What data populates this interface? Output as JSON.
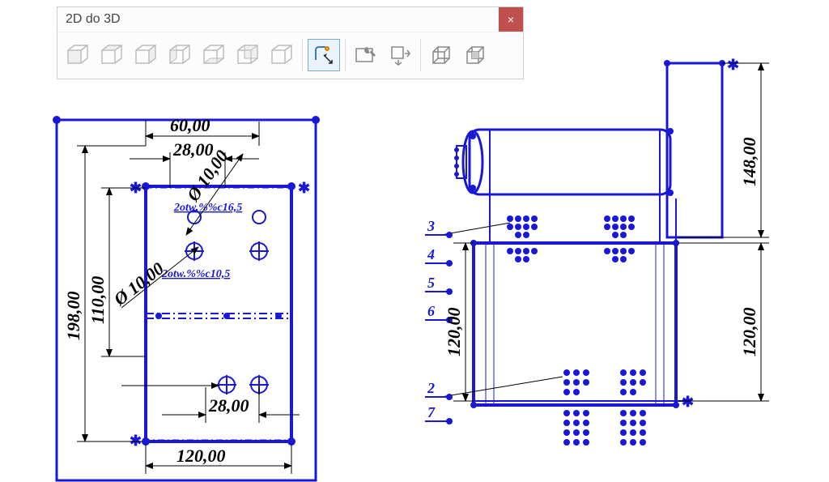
{
  "toolbar": {
    "title": "2D do 3D",
    "close": "×",
    "buttons": [
      {
        "name": "front-view"
      },
      {
        "name": "top-view"
      },
      {
        "name": "right-view"
      },
      {
        "name": "left-view"
      },
      {
        "name": "bottom-view"
      },
      {
        "name": "back-view"
      },
      {
        "name": "aux-view"
      },
      {
        "name": "sketch-from-selection"
      },
      {
        "name": "repair-sketch"
      },
      {
        "name": "align-sketch"
      },
      {
        "name": "extrude"
      },
      {
        "name": "cut"
      }
    ]
  },
  "drawing": {
    "left_view": {
      "dims": {
        "d60": "60,00",
        "d28_top": "28,00",
        "d28_bot": "28,00",
        "d120": "120,00",
        "d110": "110,00",
        "d198": "198,00",
        "phi10": "Ø 10,00",
        "phi13": "Ø 10,00"
      },
      "notes": {
        "n1": "2otw.%%c16,5",
        "n2": "2otw.%%c10,5"
      }
    },
    "right_view": {
      "dims": {
        "d148": "148,00",
        "d120l": "120,00",
        "d120r": "120,00"
      },
      "markers": [
        "3",
        "4",
        "5",
        "6",
        "2",
        "7"
      ]
    }
  }
}
